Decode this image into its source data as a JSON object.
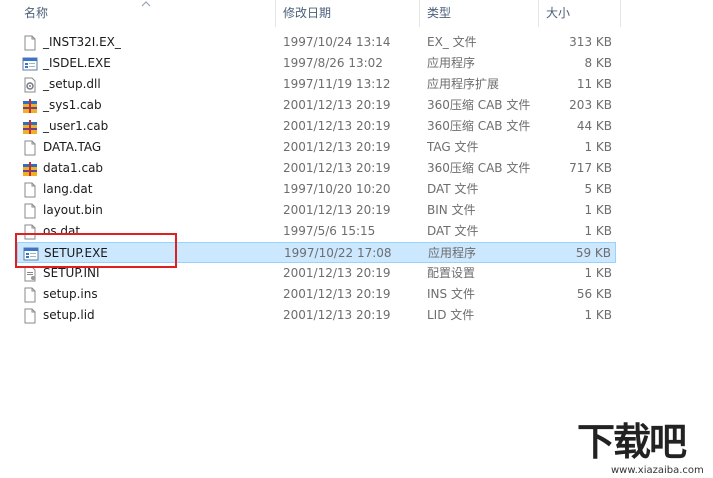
{
  "columns": {
    "name": "名称",
    "date": "修改日期",
    "type": "类型",
    "size": "大小"
  },
  "files": [
    {
      "name": "_INST32I.EX_",
      "date": "1997/10/24 13:14",
      "type": "EX_ 文件",
      "size": "313 KB",
      "icon": "generic-file-icon"
    },
    {
      "name": "_ISDEL.EXE",
      "date": "1997/8/26 13:02",
      "type": "应用程序",
      "size": "8 KB",
      "icon": "exe-icon"
    },
    {
      "name": "_setup.dll",
      "date": "1997/11/19 13:12",
      "type": "应用程序扩展",
      "size": "11 KB",
      "icon": "dll-icon"
    },
    {
      "name": "_sys1.cab",
      "date": "2001/12/13 20:19",
      "type": "360压缩 CAB 文件",
      "size": "203 KB",
      "icon": "archive-icon"
    },
    {
      "name": "_user1.cab",
      "date": "2001/12/13 20:19",
      "type": "360压缩 CAB 文件",
      "size": "44 KB",
      "icon": "archive-icon"
    },
    {
      "name": "DATA.TAG",
      "date": "2001/12/13 20:19",
      "type": "TAG 文件",
      "size": "1 KB",
      "icon": "generic-file-icon"
    },
    {
      "name": "data1.cab",
      "date": "2001/12/13 20:19",
      "type": "360压缩 CAB 文件",
      "size": "717 KB",
      "icon": "archive-icon"
    },
    {
      "name": "lang.dat",
      "date": "1997/10/20 10:20",
      "type": "DAT 文件",
      "size": "5 KB",
      "icon": "generic-file-icon"
    },
    {
      "name": "layout.bin",
      "date": "2001/12/13 20:19",
      "type": "BIN 文件",
      "size": "1 KB",
      "icon": "generic-file-icon"
    },
    {
      "name": "os.dat",
      "date": "1997/5/6 15:15",
      "type": "DAT 文件",
      "size": "1 KB",
      "icon": "generic-file-icon"
    },
    {
      "name": "SETUP.EXE",
      "date": "1997/10/22 17:08",
      "type": "应用程序",
      "size": "59 KB",
      "icon": "exe-icon",
      "selected": true
    },
    {
      "name": "SETUP.INI",
      "date": "2001/12/13 20:19",
      "type": "配置设置",
      "size": "1 KB",
      "icon": "ini-icon"
    },
    {
      "name": "setup.ins",
      "date": "2001/12/13 20:19",
      "type": "INS 文件",
      "size": "56 KB",
      "icon": "generic-file-icon"
    },
    {
      "name": "setup.lid",
      "date": "2001/12/13 20:19",
      "type": "LID 文件",
      "size": "1 KB",
      "icon": "generic-file-icon"
    }
  ],
  "watermark": {
    "logo": "下载吧",
    "url": "www.xiazaiba.com"
  },
  "colors": {
    "selection": "#cce8ff",
    "selection_border": "#99d1ff",
    "highlight": "#e02020",
    "header_text": "#4c607a"
  }
}
